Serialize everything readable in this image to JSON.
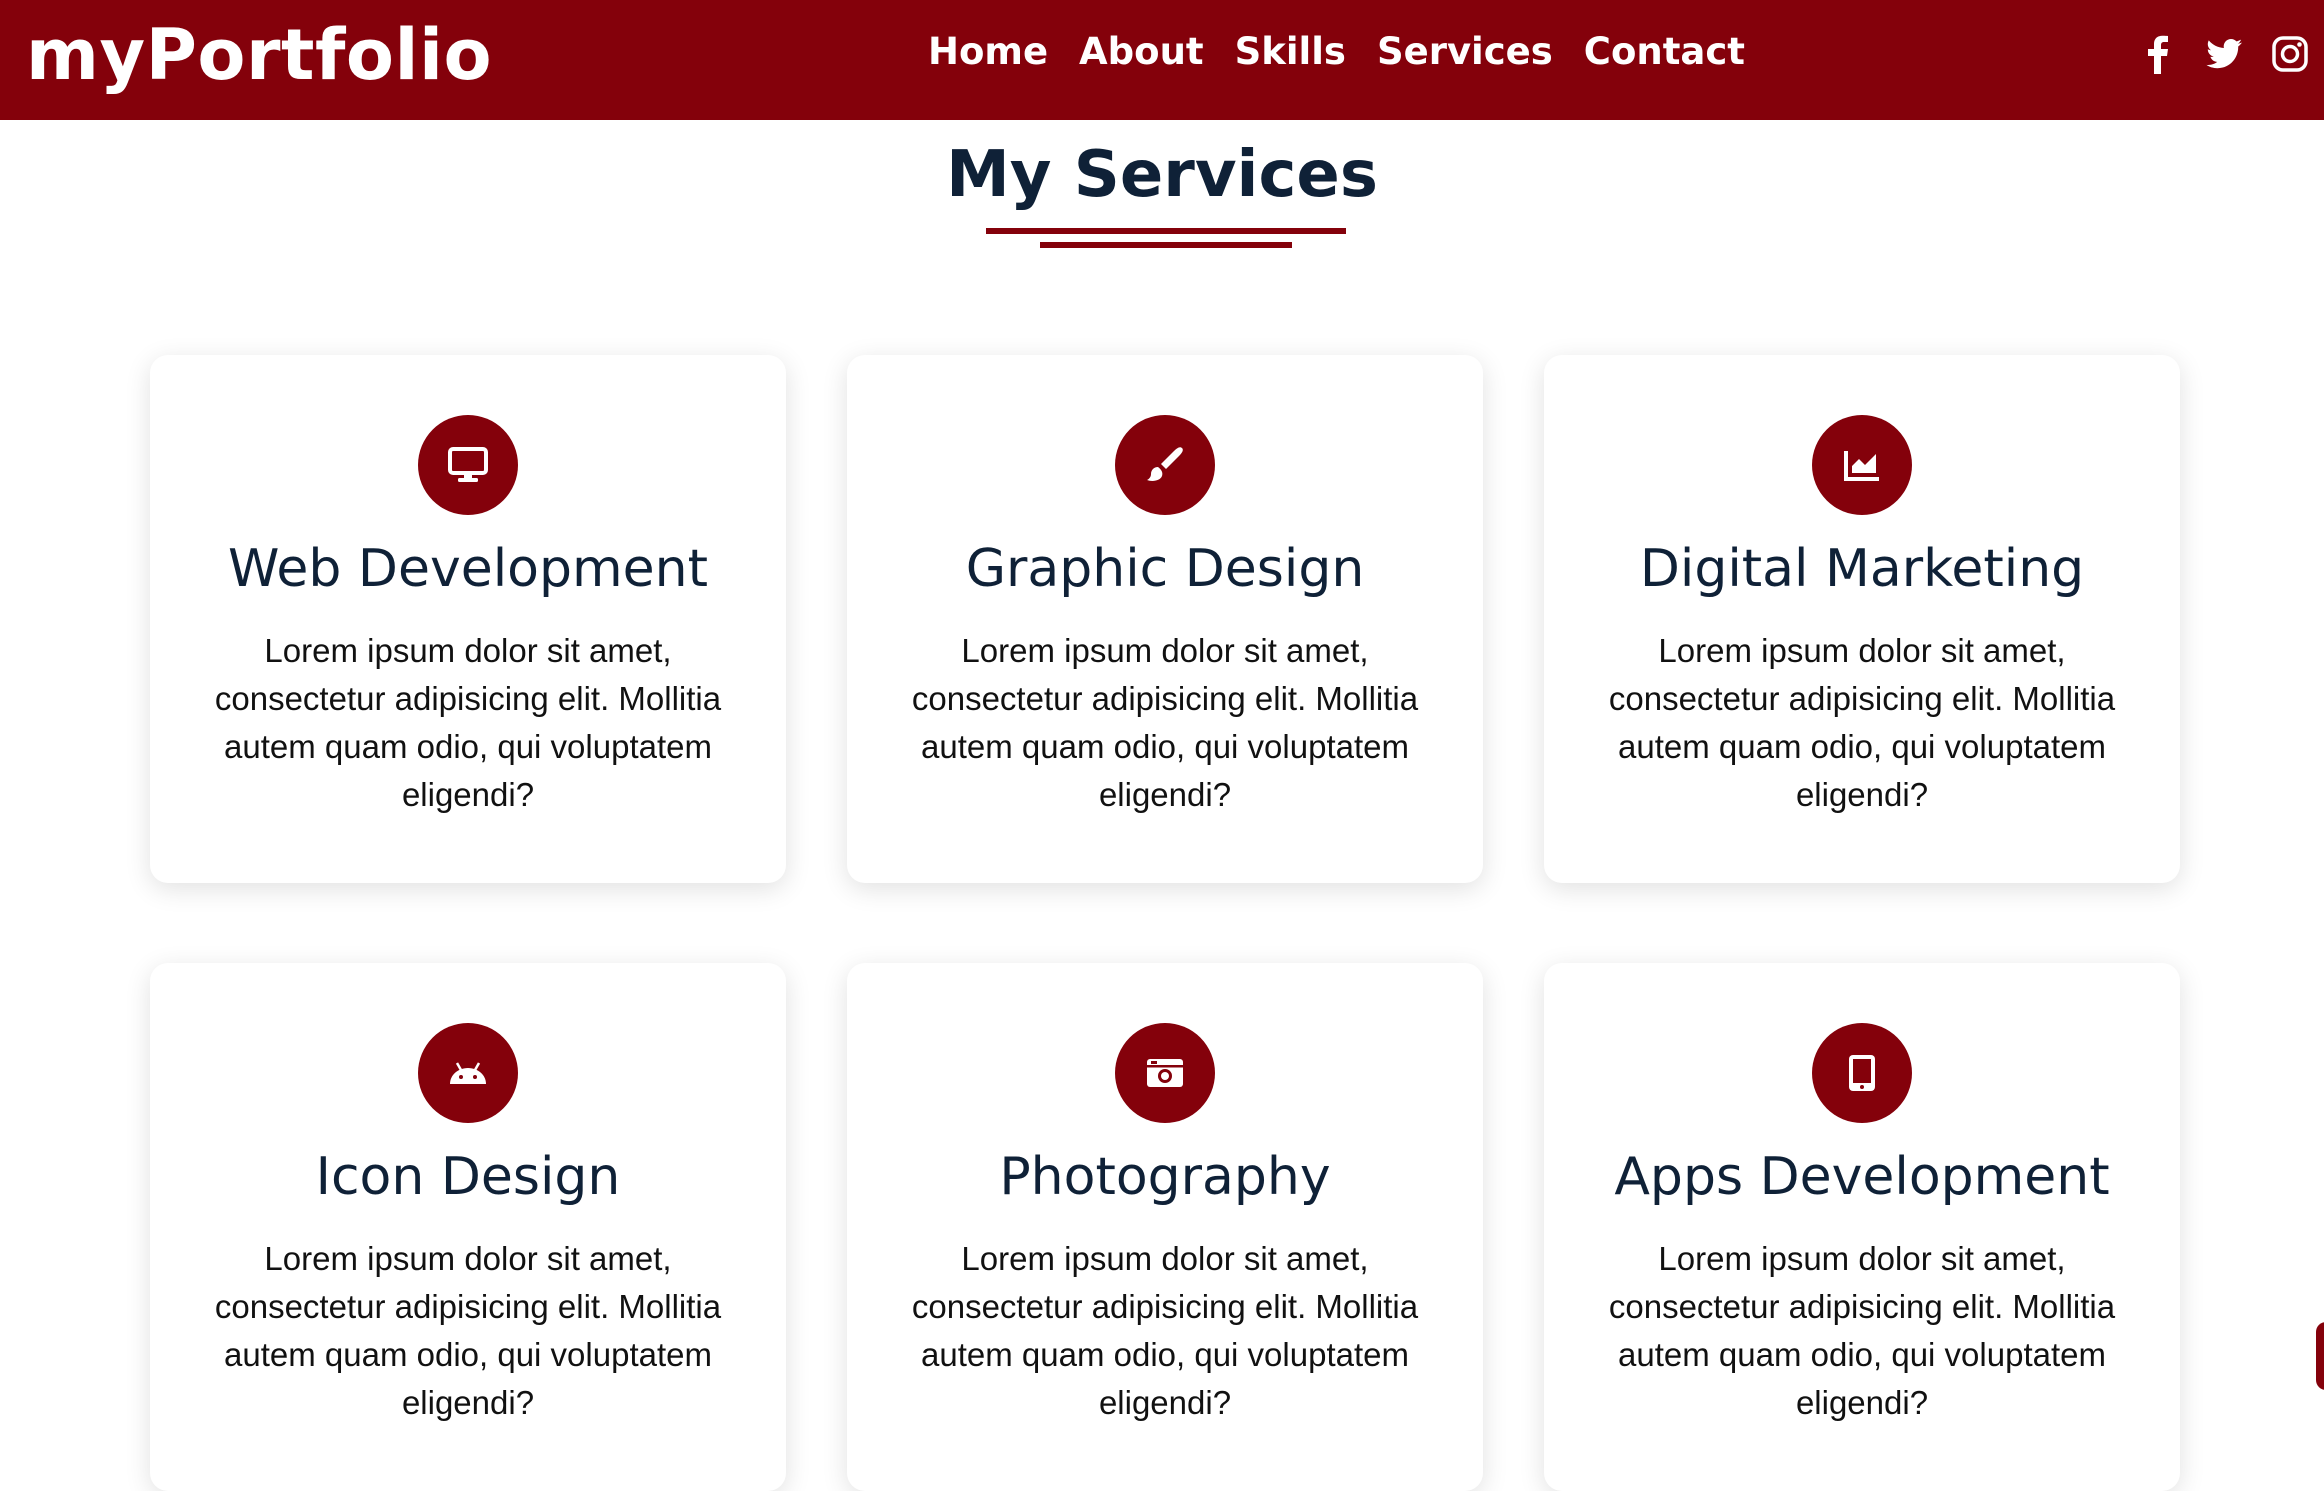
{
  "brand": {
    "logo": "myPortfolio",
    "accent_color": "#84010b",
    "heading_color": "#0f2137"
  },
  "nav": {
    "items": [
      "Home",
      "About",
      "Skills",
      "Services",
      "Contact"
    ],
    "social": [
      "facebook-icon",
      "twitter-icon",
      "instagram-icon"
    ]
  },
  "services": {
    "title": "My Services",
    "cards": [
      {
        "icon": "desktop-icon",
        "title": "Web Development",
        "text": "Lorem ipsum dolor sit amet, consectetur adipisicing elit. Mollitia autem quam odio, qui voluptatem eligendi?"
      },
      {
        "icon": "paint-brush-icon",
        "title": "Graphic Design",
        "text": "Lorem ipsum dolor sit amet, consectetur adipisicing elit. Mollitia autem quam odio, qui voluptatem eligendi?"
      },
      {
        "icon": "chart-area-icon",
        "title": "Digital Marketing",
        "text": "Lorem ipsum dolor sit amet, consectetur adipisicing elit. Mollitia autem quam odio, qui voluptatem eligendi?"
      },
      {
        "icon": "android-icon",
        "title": "Icon Design",
        "text": "Lorem ipsum dolor sit amet, consectetur adipisicing elit. Mollitia autem quam odio, qui voluptatem eligendi?"
      },
      {
        "icon": "camera-retro-icon",
        "title": "Photography",
        "text": "Lorem ipsum dolor sit amet, consectetur adipisicing elit. Mollitia autem quam odio, qui voluptatem eligendi?"
      },
      {
        "icon": "tablet-icon",
        "title": "Apps Development",
        "text": "Lorem ipsum dolor sit amet, consectetur adipisicing elit. Mollitia autem quam odio, qui voluptatem eligendi?"
      }
    ]
  }
}
